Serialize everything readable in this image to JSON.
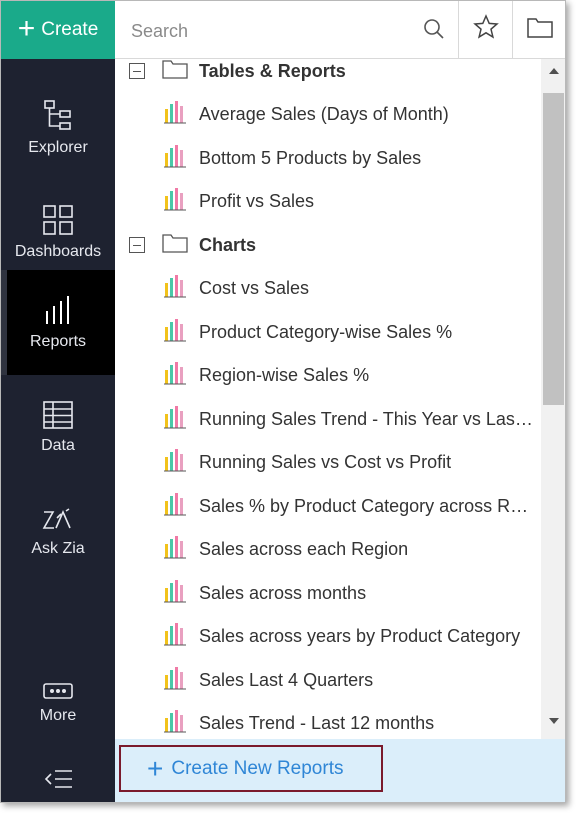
{
  "sidebar": {
    "create_label": "Create",
    "nav": [
      {
        "label": "Explorer",
        "icon": "explorer-icon"
      },
      {
        "label": "Dashboards",
        "icon": "dashboards-icon"
      },
      {
        "label": "Reports",
        "icon": "reports-icon",
        "active": true
      },
      {
        "label": "Data",
        "icon": "data-icon"
      },
      {
        "label": "Ask Zia",
        "icon": "ask-zia-icon"
      },
      {
        "label": "More",
        "icon": "more-icon"
      }
    ]
  },
  "search": {
    "placeholder": "Search"
  },
  "folders": [
    {
      "name": "Tables & Reports",
      "items": [
        "Average Sales (Days of Month)",
        "Bottom 5 Products by Sales",
        "Profit vs Sales"
      ]
    },
    {
      "name": "Charts",
      "items": [
        "Cost vs Sales",
        "Product Category-wise Sales %",
        "Region-wise Sales %",
        "Running Sales Trend - This Year vs Last Year",
        "Running Sales vs Cost vs Profit",
        "Sales % by Product Category across Regions",
        "Sales across each Region",
        "Sales across months",
        "Sales across years by Product Category",
        "Sales Last 4 Quarters",
        "Sales Trend - Last 12 months"
      ]
    }
  ],
  "footer": {
    "new_report_label": "Create New Reports"
  },
  "colors": {
    "accent": "#1aaa8a",
    "sidebar_bg": "#1e2230",
    "active_bg": "#000000",
    "link_blue": "#2f86d6",
    "highlight_border": "#7a1a2c"
  }
}
